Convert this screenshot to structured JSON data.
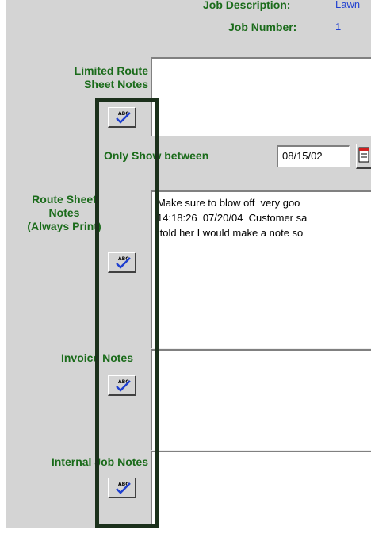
{
  "header": {
    "job_description_label": "Job Description:",
    "job_description_value": "Lawn",
    "job_number_label": "Job Number:",
    "job_number_value": "1"
  },
  "sections": {
    "limited_route": {
      "label": "Limited Route\nSheet Notes",
      "text": ""
    },
    "only_show": {
      "label": "Only Show between",
      "date": "08/15/02"
    },
    "route_sheet": {
      "label": "Route Sheet\nNotes\n(Always Print)",
      "text": "Make sure to blow off  very goo\n14:18:26  07/20/04  Customer sa\n told her I would make a note so"
    },
    "invoice": {
      "label": "Invoice Notes",
      "text": ""
    },
    "internal_job": {
      "label": "Internal Job Notes",
      "text": ""
    }
  },
  "spell_check_icon": "spell-check-icon",
  "calendar_icon": "calendar-icon",
  "colors": {
    "label_green": "#1a6b1a",
    "value_blue": "#1f3fd0",
    "highlight": "#1b301b",
    "panel_gray": "#d4d4d4"
  }
}
